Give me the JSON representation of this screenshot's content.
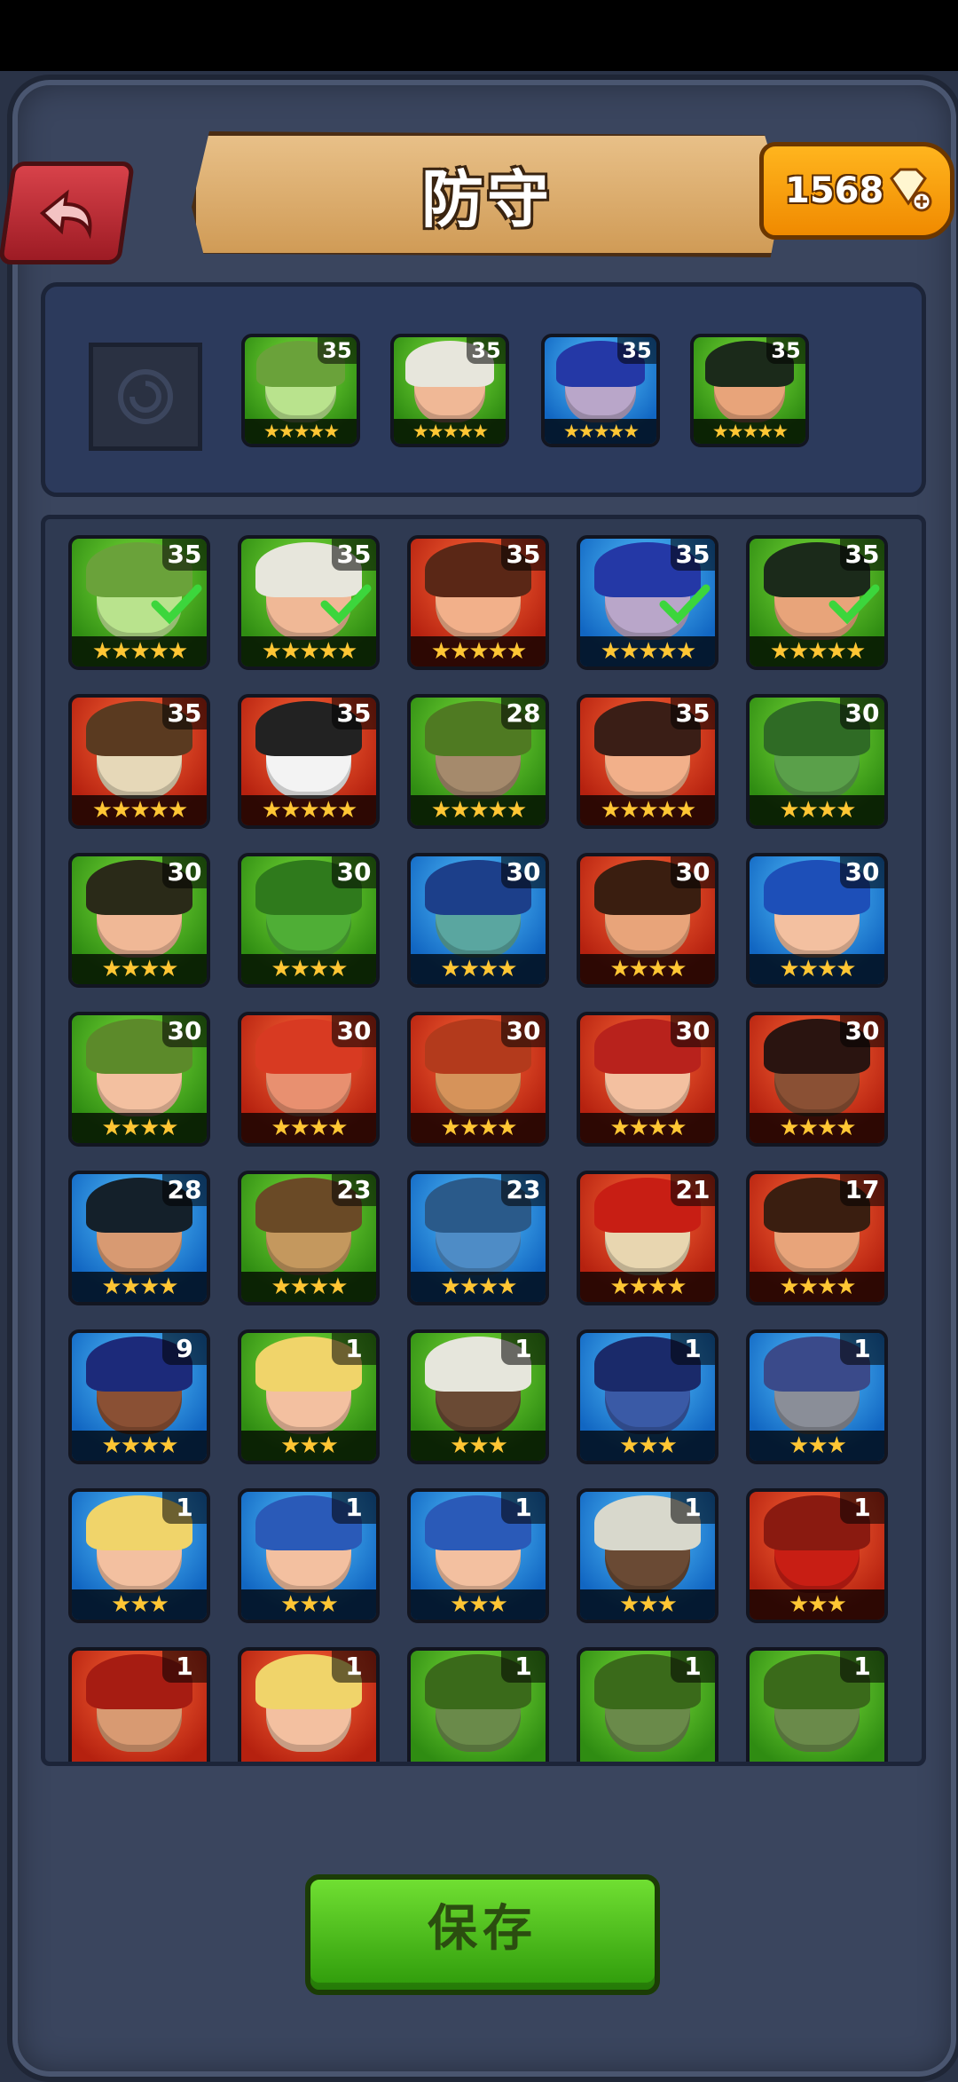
{
  "header": {
    "title": "防守",
    "gems": "1568"
  },
  "team": [
    {
      "level": "35",
      "stars": "★★★★★",
      "bg": "green",
      "skin": "#b9e38d",
      "hair": "#6aa23a"
    },
    {
      "level": "35",
      "stars": "★★★★★",
      "bg": "green",
      "skin": "#f0b896",
      "hair": "#e7e6dc"
    },
    {
      "level": "35",
      "stars": "★★★★★",
      "bg": "blue",
      "skin": "#b9a6c9",
      "hair": "#2438a6"
    },
    {
      "level": "35",
      "stars": "★★★★★",
      "bg": "green",
      "skin": "#e8a47a",
      "hair": "#1b2a1a"
    }
  ],
  "heroes": [
    {
      "level": "35",
      "stars": "★★★★★",
      "bg": "green",
      "skin": "#b9e38d",
      "hair": "#6aa23a",
      "check": true
    },
    {
      "level": "35",
      "stars": "★★★★★",
      "bg": "green",
      "skin": "#f0b896",
      "hair": "#e7e6dc",
      "check": true
    },
    {
      "level": "35",
      "stars": "★★★★★",
      "bg": "red",
      "skin": "#f2b08a",
      "hair": "#5a2716",
      "check": false
    },
    {
      "level": "35",
      "stars": "★★★★★",
      "bg": "blue",
      "skin": "#b9a6c9",
      "hair": "#2438a6",
      "check": true
    },
    {
      "level": "35",
      "stars": "★★★★★",
      "bg": "green",
      "skin": "#e8a47a",
      "hair": "#1b2a1a",
      "check": true
    },
    {
      "level": "35",
      "stars": "★★★★★",
      "bg": "red",
      "skin": "#e6d8b8",
      "hair": "#5a3a20",
      "check": false
    },
    {
      "level": "35",
      "stars": "★★★★★",
      "bg": "red",
      "skin": "#f3f3f3",
      "hair": "#222222",
      "check": false
    },
    {
      "level": "28",
      "stars": "★★★★★",
      "bg": "green",
      "skin": "#a58a6c",
      "hair": "#4f7a22",
      "check": false
    },
    {
      "level": "35",
      "stars": "★★★★★",
      "bg": "red",
      "skin": "#f2b08a",
      "hair": "#3a1e16",
      "check": false
    },
    {
      "level": "30",
      "stars": "★★★★",
      "bg": "green",
      "skin": "#5aa04a",
      "hair": "#2f6b25",
      "check": false
    },
    {
      "level": "30",
      "stars": "★★★★",
      "bg": "green",
      "skin": "#f0b896",
      "hair": "#2a2a18",
      "check": false
    },
    {
      "level": "30",
      "stars": "★★★★",
      "bg": "green",
      "skin": "#4fae36",
      "hair": "#2f7a1c",
      "check": false
    },
    {
      "level": "30",
      "stars": "★★★★",
      "bg": "blue",
      "skin": "#5aa6a0",
      "hair": "#1c3f8a",
      "check": false
    },
    {
      "level": "30",
      "stars": "★★★★",
      "bg": "red",
      "skin": "#e8a47a",
      "hair": "#3a1e10",
      "check": false
    },
    {
      "level": "30",
      "stars": "★★★★",
      "bg": "blue",
      "skin": "#f3c0a0",
      "hair": "#1d4fb8",
      "check": false
    },
    {
      "level": "30",
      "stars": "★★★★",
      "bg": "green",
      "skin": "#f3c0a0",
      "hair": "#5c8a2a",
      "check": false
    },
    {
      "level": "30",
      "stars": "★★★★",
      "bg": "red",
      "skin": "#e89070",
      "hair": "#d83a22",
      "check": false
    },
    {
      "level": "30",
      "stars": "★★★★",
      "bg": "red",
      "skin": "#d6935a",
      "hair": "#b33a1c",
      "check": false
    },
    {
      "level": "30",
      "stars": "★★★★",
      "bg": "red",
      "skin": "#f3c0a0",
      "hair": "#b8221c",
      "check": false
    },
    {
      "level": "30",
      "stars": "★★★★",
      "bg": "red",
      "skin": "#8a5034",
      "hair": "#2a1410",
      "check": false
    },
    {
      "level": "28",
      "stars": "★★★★",
      "bg": "blue",
      "skin": "#d89a72",
      "hair": "#14202a",
      "check": false
    },
    {
      "level": "23",
      "stars": "★★★★",
      "bg": "green",
      "skin": "#c4985e",
      "hair": "#6a4a26",
      "check": false
    },
    {
      "level": "23",
      "stars": "★★★★",
      "bg": "blue",
      "skin": "#4e8cc6",
      "hair": "#2a5a8a",
      "check": false
    },
    {
      "level": "21",
      "stars": "★★★★",
      "bg": "red",
      "skin": "#e8d6b0",
      "hair": "#c81e14",
      "check": false
    },
    {
      "level": "17",
      "stars": "★★★★",
      "bg": "red",
      "skin": "#e8a47a",
      "hair": "#3a1e10",
      "check": false
    },
    {
      "level": "9",
      "stars": "★★★★",
      "bg": "blue",
      "skin": "#8a5034",
      "hair": "#1c2a7a",
      "check": false
    },
    {
      "level": "1",
      "stars": "★★★",
      "bg": "green",
      "skin": "#f3c0a0",
      "hair": "#f0d46a",
      "check": false
    },
    {
      "level": "1",
      "stars": "★★★",
      "bg": "green",
      "skin": "#6a4a34",
      "hair": "#e6e6dc",
      "check": false
    },
    {
      "level": "1",
      "stars": "★★★",
      "bg": "blue",
      "skin": "#3a5aa6",
      "hair": "#1a2a6a",
      "check": false
    },
    {
      "level": "1",
      "stars": "★★★",
      "bg": "blue",
      "skin": "#8a8e98",
      "hair": "#3a4a8a",
      "check": false
    },
    {
      "level": "1",
      "stars": "★★★",
      "bg": "blue",
      "skin": "#f3c0a0",
      "hair": "#f0d46a",
      "check": false
    },
    {
      "level": "1",
      "stars": "★★★",
      "bg": "blue",
      "skin": "#f3c0a0",
      "hair": "#2a5ab8",
      "check": false
    },
    {
      "level": "1",
      "stars": "★★★",
      "bg": "blue",
      "skin": "#f3c0a0",
      "hair": "#2a5ab8",
      "check": false
    },
    {
      "level": "1",
      "stars": "★★★",
      "bg": "blue",
      "skin": "#6a4a34",
      "hair": "#d8d8cc",
      "check": false
    },
    {
      "level": "1",
      "stars": "★★★",
      "bg": "red",
      "skin": "#c81e14",
      "hair": "#8a1a10",
      "check": false
    },
    {
      "level": "1",
      "stars": "",
      "bg": "red",
      "skin": "#d89a72",
      "hair": "#a61c12",
      "check": false
    },
    {
      "level": "1",
      "stars": "",
      "bg": "red",
      "skin": "#f3c0a0",
      "hair": "#f0d46a",
      "check": false
    },
    {
      "level": "1",
      "stars": "",
      "bg": "green",
      "skin": "#6a8a4a",
      "hair": "#3a6a1a",
      "check": false
    },
    {
      "level": "1",
      "stars": "",
      "bg": "green",
      "skin": "#6a8a4a",
      "hair": "#3a6a1a",
      "check": false
    },
    {
      "level": "1",
      "stars": "",
      "bg": "green",
      "skin": "#6a8a4a",
      "hair": "#3a6a1a",
      "check": false
    }
  ],
  "save_label": "保存"
}
